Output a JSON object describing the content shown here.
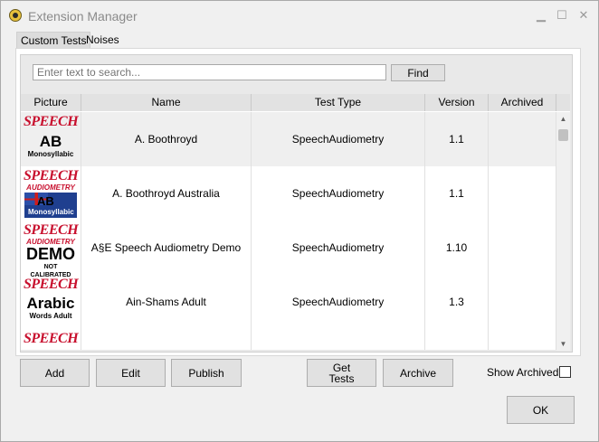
{
  "window": {
    "title": "Extension Manager",
    "minimize_icon": "minimize-icon",
    "maximize_icon": "maximize-icon",
    "close_icon": "close-icon"
  },
  "tabs": [
    {
      "label": "Custom Tests",
      "active": true
    },
    {
      "label": "Noises",
      "active": false
    }
  ],
  "search": {
    "placeholder": "Enter text to search...",
    "button_label": "Find"
  },
  "table": {
    "columns": [
      "Picture",
      "Name",
      "Test Type",
      "Version",
      "Archived"
    ],
    "rows": [
      {
        "name": "A. Boothroyd",
        "test_type": "SpeechAudiometry",
        "version": "1.1",
        "archived": "",
        "thumb": {
          "top": "SPEECH",
          "sub": "",
          "main": "AB",
          "bottom": "Monosyllabic"
        }
      },
      {
        "name": "A. Boothroyd Australia",
        "test_type": "SpeechAudiometry",
        "version": "1.1",
        "archived": "",
        "thumb": {
          "top": "SPEECH",
          "sub": "AUDIOMETRY",
          "main": "AB",
          "bottom": "Monosyllabic"
        }
      },
      {
        "name": "A§E Speech Audiometry Demo",
        "test_type": "SpeechAudiometry",
        "version": "1.10",
        "archived": "",
        "thumb": {
          "top": "SPEECH",
          "sub": "AUDIOMETRY",
          "main": "DEMO",
          "bottom": "NOT CALIBRATED"
        }
      },
      {
        "name": "Ain-Shams Adult",
        "test_type": "SpeechAudiometry",
        "version": "1.3",
        "archived": "",
        "thumb": {
          "top": "SPEECH",
          "sub": "",
          "main": "Arabic",
          "bottom": "Words Adult"
        }
      },
      {
        "name": "",
        "test_type": "",
        "version": "",
        "archived": "",
        "thumb": {
          "top": "SPEECH",
          "sub": "",
          "main": "",
          "bottom": ""
        }
      }
    ]
  },
  "buttons": {
    "add": "Add",
    "edit": "Edit",
    "publish": "Publish",
    "get_tests_line1": "Get",
    "get_tests_line2": "Tests",
    "archive": "Archive",
    "ok": "OK"
  },
  "show_archived": {
    "label": "Show Archived",
    "checked": false
  },
  "colors": {
    "speech_red": "#c8102e",
    "header_gray": "#e2e2e2"
  }
}
